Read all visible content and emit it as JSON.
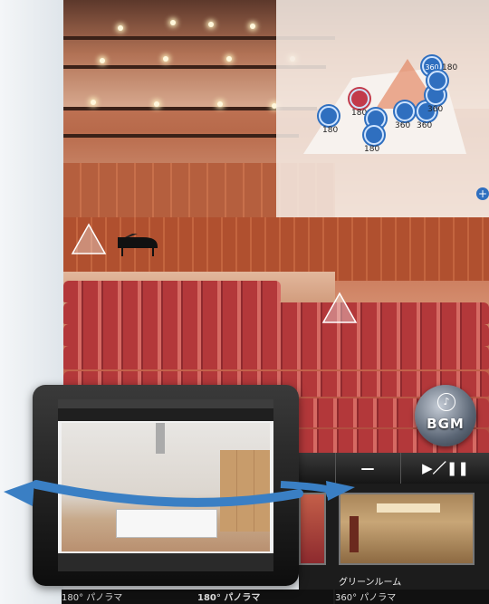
{
  "floor_map": {
    "hotspots": [
      {
        "label": "360"
      },
      {
        "label": "180",
        "active": true
      },
      {
        "label": "180"
      },
      {
        "label": "180"
      },
      {
        "label": "360"
      },
      {
        "label": "360"
      },
      {
        "label": "360"
      },
      {
        "label": "180"
      },
      {
        "label": "180"
      }
    ],
    "zoom_symbol": "+"
  },
  "bgm": {
    "label": "BGM",
    "icon": "music-note-icon",
    "glyph": "♪"
  },
  "controls": {
    "minus_label": "—",
    "play_pause_label": "▶／❚❚"
  },
  "thumbnails": [
    {
      "name": "グリーンルーム"
    }
  ],
  "captions": [
    {
      "text": "180° パノラマ"
    },
    {
      "text": "180° パノラマ"
    },
    {
      "text": "360° パノラマ"
    }
  ],
  "colors": {
    "hotspot": "#2f6fbf",
    "hotspot_active": "#c23a4a",
    "arrow": "#3a7fc4"
  }
}
